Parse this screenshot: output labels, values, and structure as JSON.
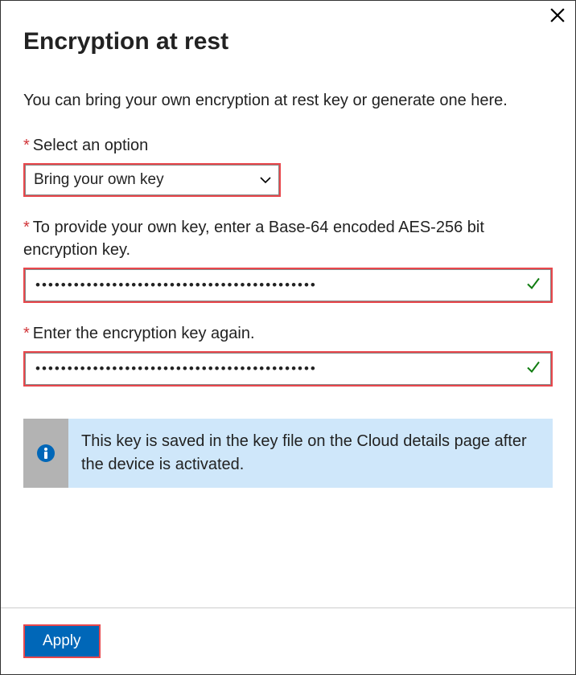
{
  "title": "Encryption at rest",
  "description": "You can bring your own encryption at rest key or generate one here.",
  "fields": {
    "select_option": {
      "label": "Select an option",
      "value": "Bring your own key"
    },
    "key_input": {
      "label": "To provide your own key, enter a Base-64 encoded AES-256 bit encryption key.",
      "masked_value": "••••••••••••••••••••••••••••••••••••••••••••"
    },
    "key_confirm": {
      "label": "Enter the encryption key again.",
      "masked_value": "••••••••••••••••••••••••••••••••••••••••••••"
    }
  },
  "info_message": "This key is saved in the key file on the Cloud details page after the device is activated.",
  "apply_label": "Apply",
  "required_marker": "*"
}
